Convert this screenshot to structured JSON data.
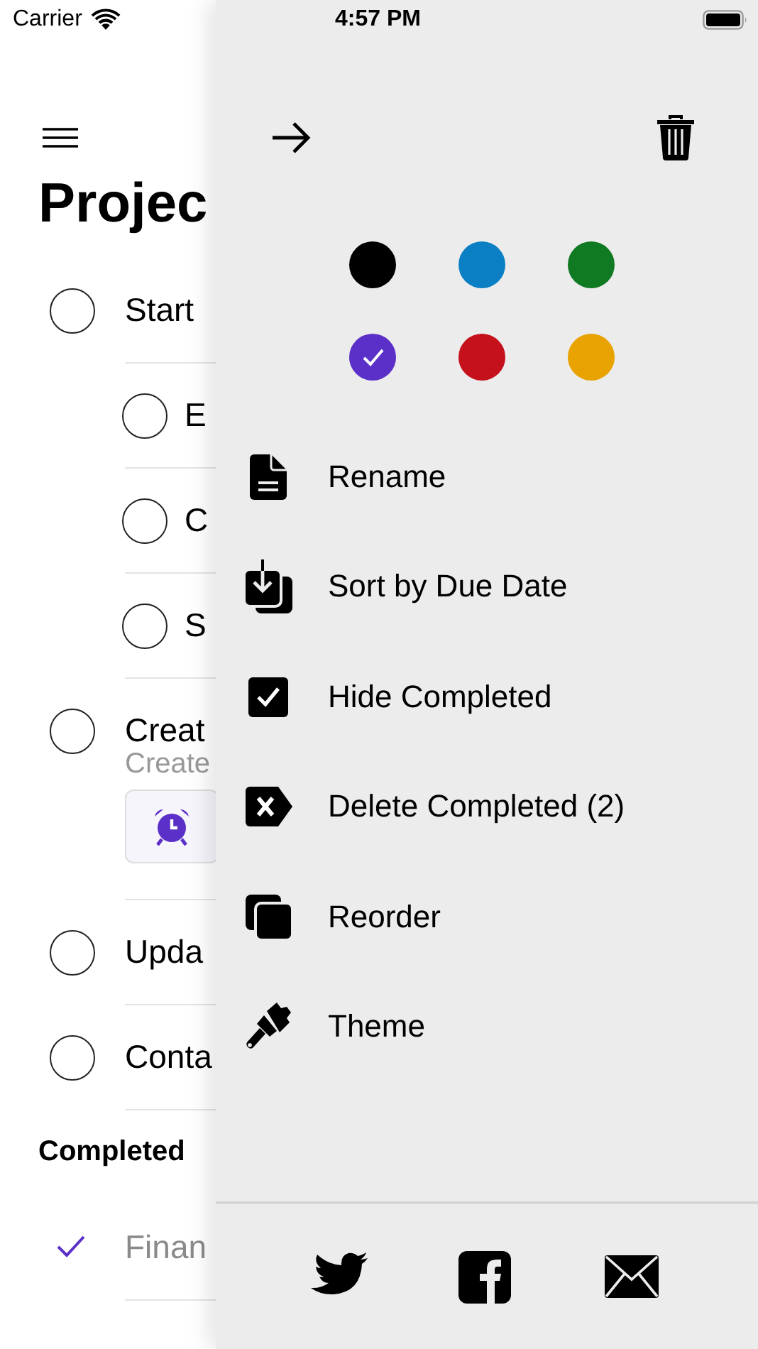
{
  "status_bar": {
    "carrier": "Carrier",
    "time": "4:57 PM"
  },
  "page": {
    "title": "Projec",
    "tasks": [
      {
        "title": "Start",
        "done": false,
        "children": [
          {
            "title": "E",
            "done": false
          },
          {
            "title": "C",
            "done": false
          },
          {
            "title": "S",
            "done": false
          }
        ]
      },
      {
        "title": "Creat",
        "subtitle": "Create",
        "reminder": true,
        "done": false
      },
      {
        "title": "Upda",
        "done": false
      },
      {
        "title": "Conta",
        "done": false
      }
    ],
    "completed": {
      "title": "Completed",
      "tasks": [
        {
          "title": "Finan",
          "done": true
        }
      ]
    }
  },
  "drawer": {
    "colors": [
      {
        "color": "#000000",
        "selected": false
      },
      {
        "color": "#0a7fc4",
        "selected": false
      },
      {
        "color": "#0f7a21",
        "selected": false
      },
      {
        "color": "#5b30c8",
        "selected": true
      },
      {
        "color": "#c4111c",
        "selected": false
      },
      {
        "color": "#e9a300",
        "selected": false
      }
    ],
    "menu": [
      {
        "kind": "action",
        "label": "Rename"
      },
      {
        "kind": "action",
        "label": "Sort by Due Date"
      },
      {
        "kind": "toggle",
        "label": "Hide Completed",
        "checked": true
      },
      {
        "kind": "action",
        "label": "Delete Completed (2)"
      },
      {
        "kind": "action",
        "label": "Reorder"
      },
      {
        "kind": "action",
        "label": "Theme"
      }
    ]
  }
}
